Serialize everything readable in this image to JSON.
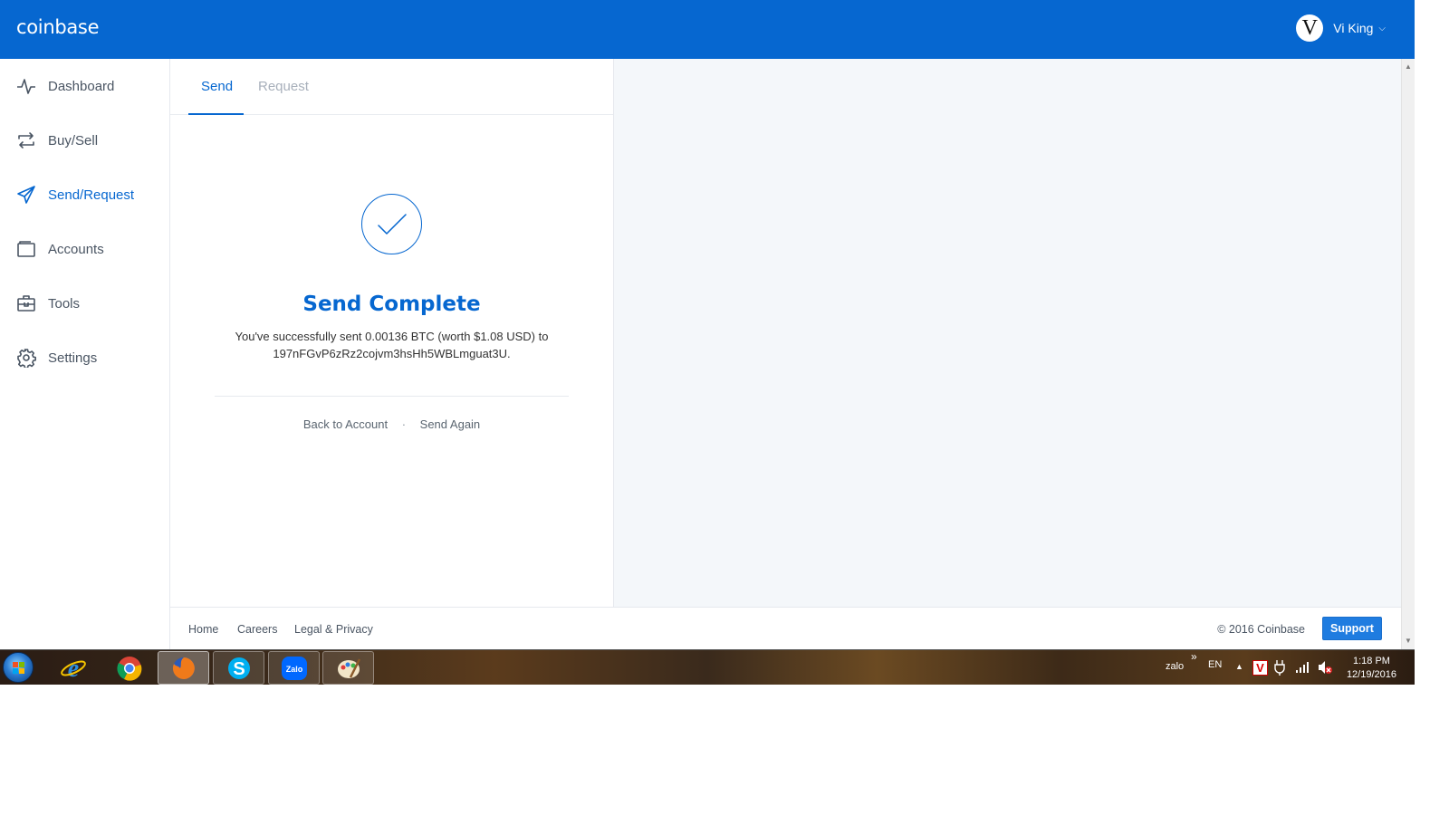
{
  "header": {
    "logo": "coinbase",
    "user_initial": "V",
    "user_name": "Vi King",
    "caret": "⌵"
  },
  "sidebar": {
    "items": [
      {
        "label": "Dashboard",
        "icon": "pulse-icon"
      },
      {
        "label": "Buy/Sell",
        "icon": "exchange-arrows-icon"
      },
      {
        "label": "Send/Request",
        "icon": "paper-plane-icon",
        "active": true
      },
      {
        "label": "Accounts",
        "icon": "wallet-icon"
      },
      {
        "label": "Tools",
        "icon": "toolbox-icon"
      },
      {
        "label": "Settings",
        "icon": "gear-icon"
      }
    ]
  },
  "panel": {
    "tabs": [
      {
        "label": "Send",
        "active": true
      },
      {
        "label": "Request",
        "active": false
      }
    ],
    "title": "Send Complete",
    "message_line1": "You've successfully sent 0.00136 BTC (worth $1.08 USD) to",
    "message_line2": "197nFGvP6zRz2cojvm3hsHh5WBLmguat3U.",
    "back_label": "Back to Account",
    "separator": "·",
    "send_again_label": "Send Again"
  },
  "footer": {
    "links": [
      "Home",
      "Careers",
      "Legal & Privacy"
    ],
    "copyright": "© 2016 Coinbase",
    "support_label": "Support"
  },
  "taskbar": {
    "apps": [
      "internet-explorer-icon",
      "chrome-icon",
      "firefox-icon",
      "skype-icon",
      "zalo-icon",
      "paint-icon"
    ],
    "zalo_label": "Zalo",
    "tray_zalo": "zalo",
    "tray_overflow": "»",
    "language": "EN",
    "show_hidden": "▲",
    "time": "1:18 PM",
    "date": "12/19/2016"
  },
  "colors": {
    "brand": "#0667d0",
    "content_gray": "#f4f7fa",
    "support_button": "#1f7ce0"
  }
}
